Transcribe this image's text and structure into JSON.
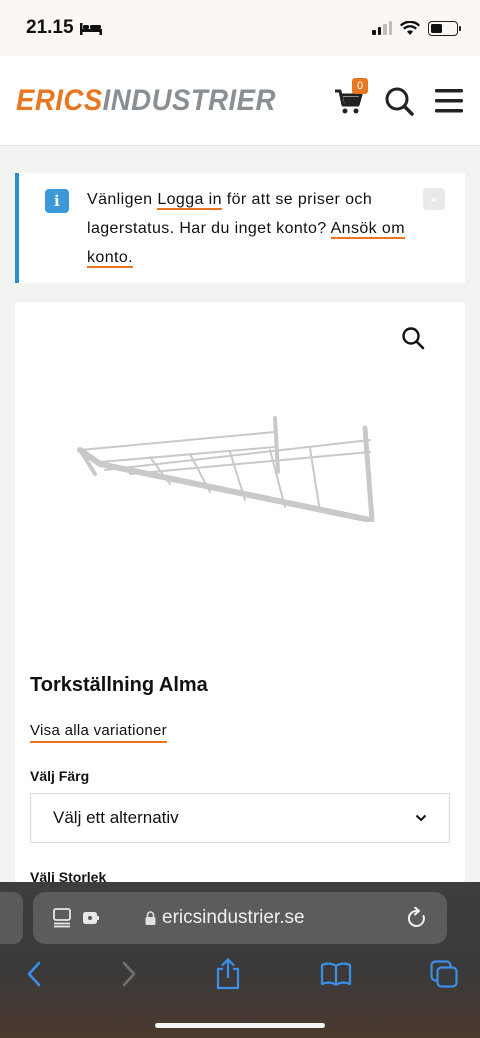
{
  "status_bar": {
    "time": "21.15"
  },
  "header": {
    "logo_part1": "ERICS",
    "logo_part2": "INDUSTRIER",
    "cart_count": "0",
    "brand_color": "#e87722"
  },
  "notice": {
    "text_before_login": "Vänligen ",
    "login_link": "Logga in",
    "text_after_login": " för att se priser och lagerstatus. Har du inget konto? ",
    "apply_link": "Ansök om konto.",
    "close_label": "×",
    "info_label": "i"
  },
  "product": {
    "title": "Torkställning Alma",
    "variations_link": "Visa alla variationer",
    "color_label": "Välj Färg",
    "color_select_value": "Välj ett alternativ",
    "size_label": "Välj Storlek"
  },
  "browser": {
    "url": "ericsindustrier.se"
  }
}
